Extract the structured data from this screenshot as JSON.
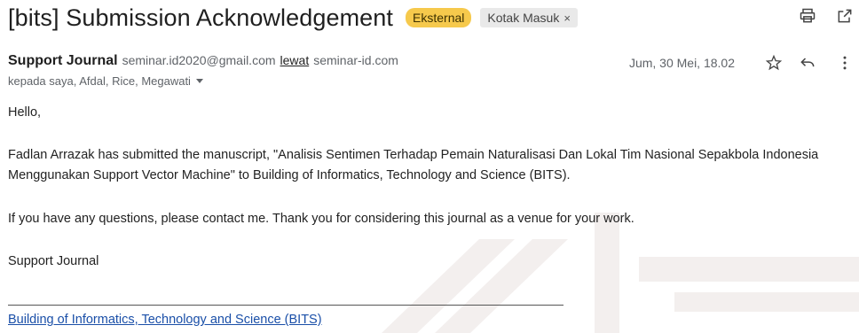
{
  "email": {
    "subject": "[bits] Submission Acknowledgement",
    "labels": {
      "external": "Eksternal",
      "inbox": "Kotak Masuk",
      "inbox_remove": "×"
    },
    "sender": {
      "name": "Support Journal",
      "email": "seminar.id2020@gmail.com",
      "via_label": "lewat",
      "via_domain": "seminar-id.com"
    },
    "date": "Jum, 30 Mei, 18.02",
    "recipients": "kepada saya, Afdal, Rice, Megawati",
    "body": {
      "greeting": "Hello,",
      "paragraph1": "Fadlan Arrazak has submitted the manuscript, \"Analisis Sentimen Terhadap Pemain Naturalisasi Dan Lokal Tim Nasional Sepakbola Indonesia Menggunakan Support Vector Machine\" to Building of Informatics, Technology and Science (BITS).",
      "paragraph2": "If you have any questions, please contact me. Thank you for considering this journal as a venue for your work.",
      "signature": "Support Journal",
      "footer_link": "Building of Informatics, Technology and Science (BITS)"
    }
  },
  "icons": {
    "print": "print-icon",
    "open_new": "open-in-new-icon",
    "star": "star-icon",
    "reply": "reply-icon",
    "more": "more-vert-icon"
  },
  "colors": {
    "external_tag": "#f6c94c",
    "inbox_tag": "#e9e9e9",
    "link": "#1a4fa8",
    "muted": "#5f6368"
  }
}
